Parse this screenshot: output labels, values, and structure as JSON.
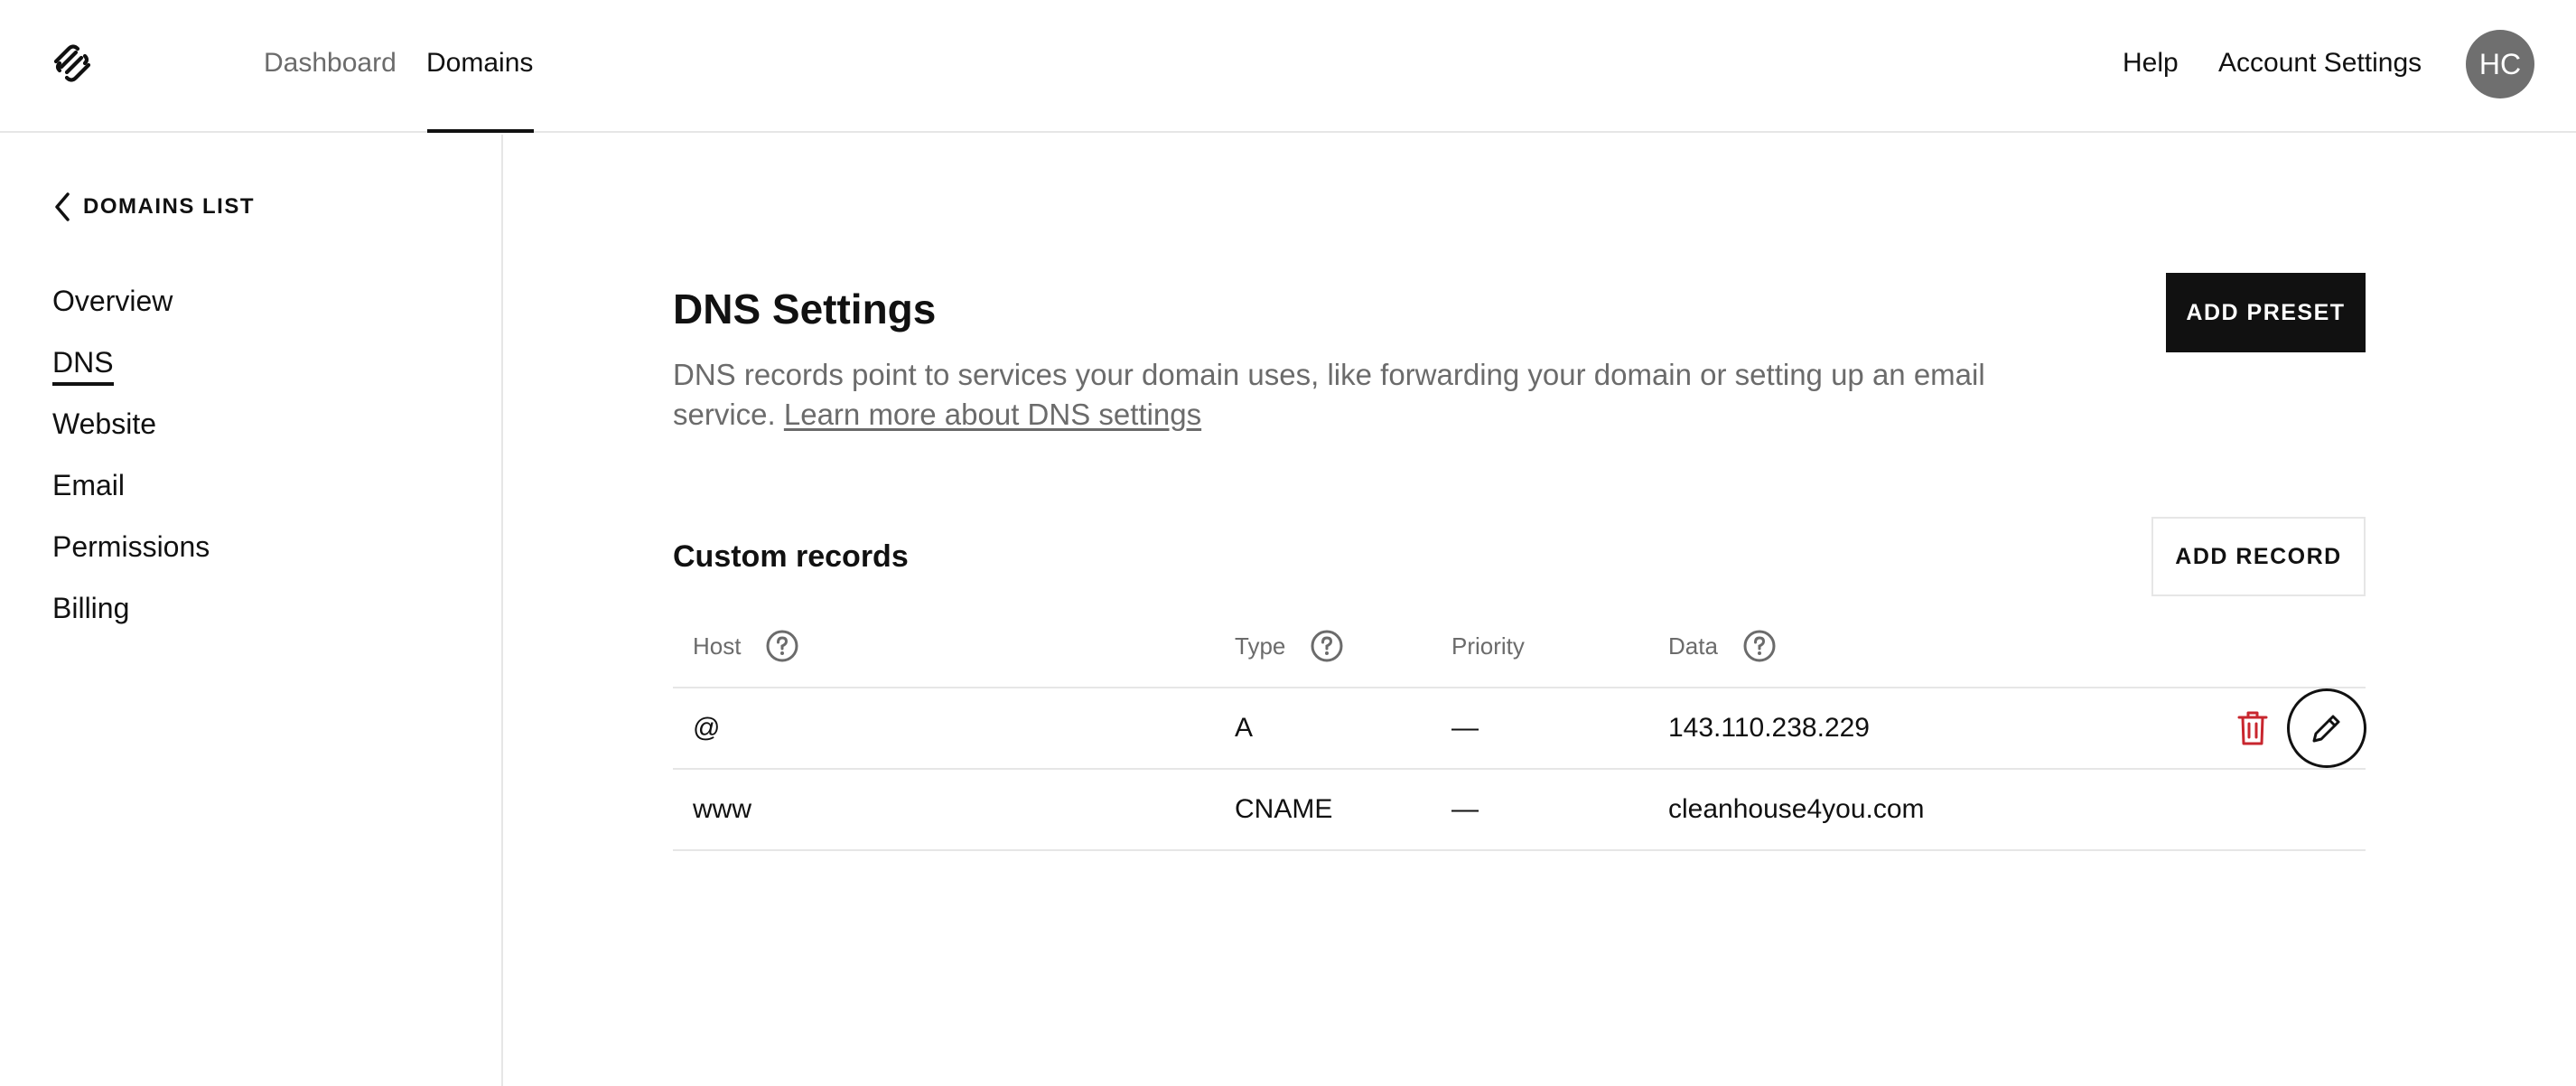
{
  "nav": {
    "tabs": [
      {
        "label": "Dashboard",
        "active": false
      },
      {
        "label": "Domains",
        "active": true
      }
    ],
    "help": "Help",
    "account_settings": "Account Settings",
    "avatar_initials": "HC"
  },
  "sidebar": {
    "back_label": "DOMAINS LIST",
    "items": [
      {
        "label": "Overview",
        "active": false
      },
      {
        "label": "DNS",
        "active": true
      },
      {
        "label": "Website",
        "active": false
      },
      {
        "label": "Email",
        "active": false
      },
      {
        "label": "Permissions",
        "active": false
      },
      {
        "label": "Billing",
        "active": false
      }
    ]
  },
  "main": {
    "title": "DNS Settings",
    "description": "DNS records point to services your domain uses, like forwarding your domain or setting up an email service.",
    "learn_more": "Learn more about DNS settings",
    "add_preset": "ADD PRESET",
    "section_title": "Custom records",
    "add_record": "ADD RECORD",
    "columns": {
      "host": "Host",
      "type": "Type",
      "priority": "Priority",
      "data": "Data"
    },
    "records": [
      {
        "host": "@",
        "type": "A",
        "priority": "—",
        "data": "143.110.238.229"
      },
      {
        "host": "www",
        "type": "CNAME",
        "priority": "—",
        "data": "cleanhouse4you.com"
      }
    ]
  },
  "colors": {
    "accent": "#111111",
    "muted_text": "#6b6b6b",
    "divider": "#e6e6e6",
    "delete": "#c8262e",
    "avatar_bg": "#6f6f6f"
  },
  "icons": [
    "squarespace-logo",
    "chevron-left-icon",
    "help-circle-icon",
    "trash-icon",
    "pencil-icon"
  ]
}
